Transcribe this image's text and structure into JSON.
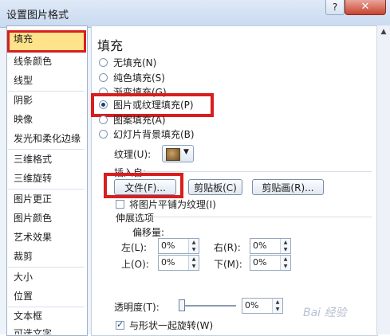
{
  "window": {
    "title": "设置图片格式",
    "help": "?",
    "close": "✕"
  },
  "sidebar": {
    "items": [
      {
        "label": "填充"
      },
      {
        "label": "线条颜色"
      },
      {
        "label": "线型"
      },
      {
        "label": "阴影"
      },
      {
        "label": "映像"
      },
      {
        "label": "发光和柔化边缘"
      },
      {
        "label": "三维格式"
      },
      {
        "label": "三维旋转"
      },
      {
        "label": "图片更正"
      },
      {
        "label": "图片颜色"
      },
      {
        "label": "艺术效果"
      },
      {
        "label": "裁剪"
      },
      {
        "label": "大小"
      },
      {
        "label": "位置"
      },
      {
        "label": "文本框"
      },
      {
        "label": "可选文字"
      }
    ],
    "selected": "填充"
  },
  "panel": {
    "heading": "填充",
    "fill_options": [
      {
        "label": "无填充(N)"
      },
      {
        "label": "纯色填充(S)"
      },
      {
        "label": "渐变填充(G)"
      },
      {
        "label": "图片或纹理填充(P)"
      },
      {
        "label": "图案填充(A)"
      },
      {
        "label": "幻灯片背景填充(B)"
      }
    ],
    "texture_label": "纹理(U):",
    "insert_from": "插入自:",
    "buttons": {
      "file": "文件(F)...",
      "clipboard": "剪贴板(C)",
      "clipart": "剪贴画(R)..."
    },
    "tile_checkbox": "将图片平铺为纹理(I)",
    "stretch_options": "伸展选项",
    "offset": "偏移量:",
    "left": {
      "label": "左(L):",
      "value": "0%"
    },
    "right": {
      "label": "右(R):",
      "value": "0%"
    },
    "top": {
      "label": "上(O):",
      "value": "0%"
    },
    "bottom": {
      "label": "下(M):",
      "value": "0%"
    },
    "transparency": {
      "label": "透明度(T):",
      "value": "0%"
    },
    "rotate_with_shape": "与形状一起旋转(W)"
  },
  "watermark": "Bai 经验",
  "colors": {
    "highlight_border": "#d81e1e",
    "selected_bg": "#ffe38a"
  }
}
